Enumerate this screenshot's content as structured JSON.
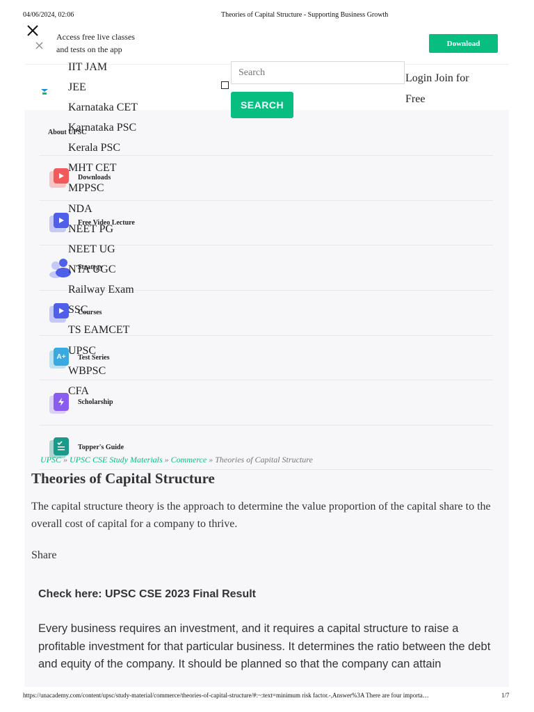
{
  "print_header": {
    "datetime": "04/06/2024, 02:06",
    "page_title": "Theories of Capital Structure - Supporting Business Growth"
  },
  "banner": {
    "text_line1": "Access free live classes",
    "text_line2": "and tests on the app",
    "download_label": "Download"
  },
  "exams": [
    "IIT JAM",
    "JEE",
    "Karnataka CET",
    "Karnataka PSC",
    "Kerala PSC",
    "MHT CET",
    "MPPSC",
    "NDA",
    "NEET PG",
    "NEET UG",
    "NTA UGC",
    "Railway Exam",
    "SSC",
    "TS EAMCET",
    "UPSC",
    "WBPSC",
    "CFA"
  ],
  "menu": [
    {
      "label": "About UPSC",
      "icon": "logo-icon"
    },
    {
      "label": "Downloads",
      "icon": "play-icon"
    },
    {
      "label": "Free Video Lecture",
      "icon": "play-icon"
    },
    {
      "label": "Strategy",
      "icon": "user-icon"
    },
    {
      "label": "Courses",
      "icon": "play-icon"
    },
    {
      "label": "Test Series",
      "icon": "test-icon"
    },
    {
      "label": "Scholarship",
      "icon": "bolt-icon"
    },
    {
      "label": "Topper's Guide",
      "icon": "list-icon"
    }
  ],
  "search": {
    "placeholder": "Search",
    "button_label": "SEARCH"
  },
  "auth": {
    "login_label": "Login",
    "join_label": "Join for Free"
  },
  "breadcrumb": {
    "items": [
      "UPSC",
      "UPSC CSE Study Materials",
      "Commerce"
    ],
    "separator": "»",
    "current": "Theories of Capital Structure"
  },
  "article": {
    "title": "Theories of Capital Structure",
    "lede": "The capital structure theory is the approach to determine the value proportion of the capital share to the overall cost of capital for a company to thrive.",
    "share_label": "Share",
    "check_here": "Check here: UPSC CSE 2023 Final Result",
    "body": "Every business requires an investment, and it requires a capital structure to raise a profitable investment for that particular business. It determines the ratio between the debt and equity of the company. It should be planned so that the company can attain"
  },
  "print_footer": {
    "url": "https://unacademy.com/content/upsc/study-material/commerce/theories-of-capital-structure/#:~:text=minimum risk factor.-,Answer%3A There are four importa…",
    "page": "1/7"
  },
  "colors": {
    "brand_green": "#08bd80",
    "panel_bg": "#f7f7f9",
    "red_icon": "#f05a5a",
    "blue_icon": "#4f5fe8",
    "teal_icon": "#1a9a8a",
    "purple_icon": "#8a5cf0"
  }
}
